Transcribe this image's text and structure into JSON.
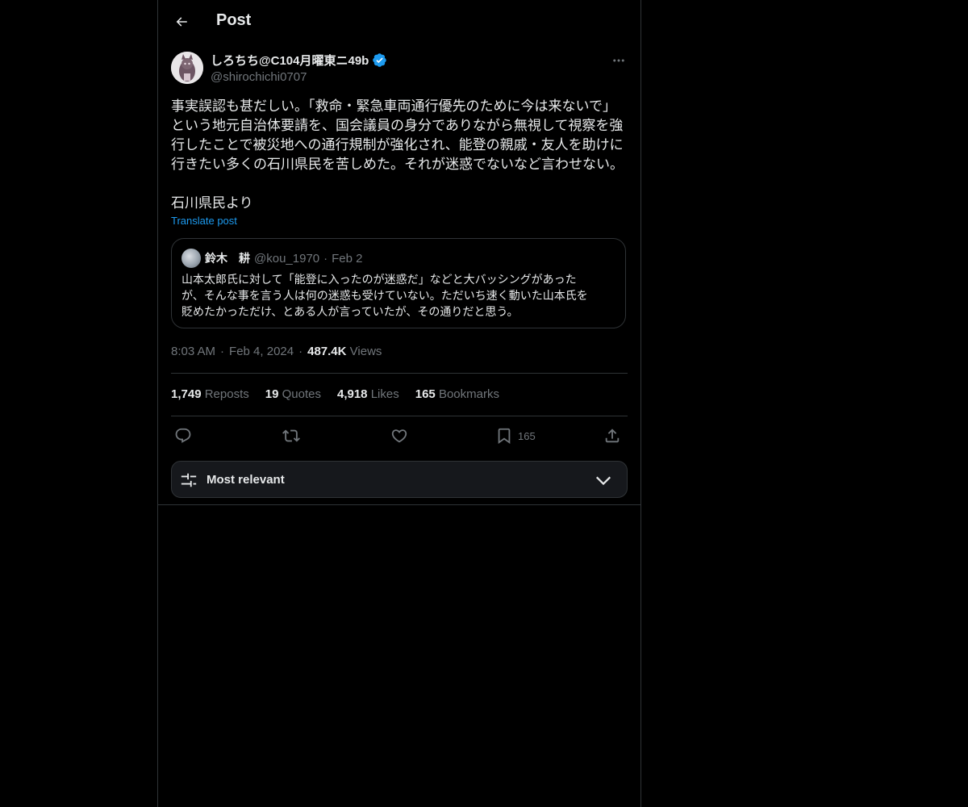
{
  "header": {
    "title": "Post"
  },
  "author": {
    "display_name": "しろちち@C104月曜東ニ49b",
    "handle": "@shirochichi0707",
    "verified": true
  },
  "post": {
    "text": "事実誤認も甚だしい。「救命・緊急車両通行優先のために今は来ないで」\nという地元自治体要請を、国会議員の身分でありながら無視して視察を強\n行したことで被災地への通行規制が強化され、能登の親戚・友人を助けに\n行きたい多くの石川県民を苦しめた。それが迷惑でないなど言わせない。\n\n石川県民より",
    "translate_label": "Translate post"
  },
  "quote": {
    "name": "鈴木　耕",
    "handle": "@kou_1970",
    "separator": "·",
    "date": "Feb 2",
    "text": "山本太郎氏に対して「能登に入ったのが迷惑だ」などと大バッシングがあった\nが、そんな事を言う人は何の迷惑も受けていない。ただいち速く動いた山本氏を\n貶めたかっただけ、とある人が言っていたが、その通りだと思う。"
  },
  "meta": {
    "time": "8:03 AM",
    "separator": "·",
    "date": "Feb 4, 2024",
    "views_count": "487.4K",
    "views_label": "Views"
  },
  "stats": {
    "reposts_count": "1,749",
    "reposts_label": "Reposts",
    "quotes_count": "19",
    "quotes_label": "Quotes",
    "likes_count": "4,918",
    "likes_label": "Likes",
    "bookmarks_count": "165",
    "bookmarks_label": "Bookmarks"
  },
  "actions": {
    "reply_icon": "reply-icon",
    "repost_icon": "repost-icon",
    "like_icon": "heart-icon",
    "bookmark_icon": "bookmark-icon",
    "bookmark_count": "165",
    "share_icon": "share-icon"
  },
  "sort": {
    "label": "Most relevant"
  },
  "colors": {
    "background": "#000000",
    "text": "#e7e9ea",
    "muted": "#71767b",
    "accent": "#1d9bf0",
    "border": "#2f3336"
  }
}
